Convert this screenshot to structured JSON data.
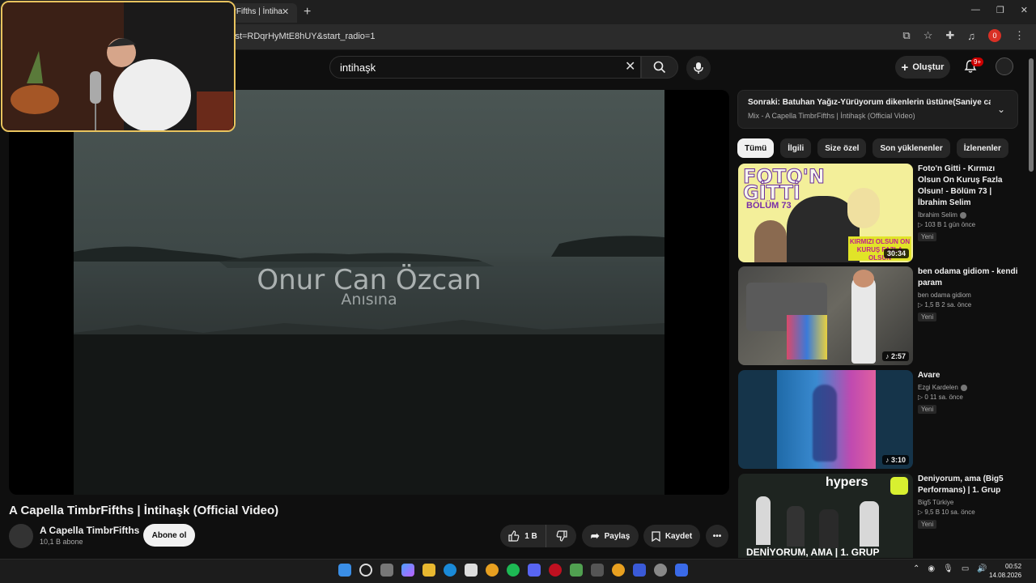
{
  "browser": {
    "tab_title": "brFifths | İntiha",
    "url": "ist=RDqrHyMtE8hUY&start_radio=1",
    "extension_badge": "0"
  },
  "header": {
    "search_value": "intihaşk",
    "create_label": "Oluştur",
    "notifications_badge": "9+"
  },
  "video": {
    "overlay_title": "Onur Can Özcan",
    "overlay_subtitle": "Anısına",
    "title": "A Capella TimbrFifths | İntihaşk (Official Video)",
    "channel": "A Capella TimbrFifths",
    "subscribers": "10,1 B abone",
    "subscribe_label": "Abone ol",
    "likes": "1 B",
    "share_label": "Paylaş",
    "save_label": "Kaydet"
  },
  "playlist": {
    "next_title": "Sonraki: Batuhan Yağız-Yürüyorum dikenlerin üstüne(Saniye canl...",
    "next_sub": "Mix - A Capella TimbrFifths | İntihaşk (Official Video)"
  },
  "chips": [
    "Tümü",
    "İlgili",
    "Size özel",
    "Son yüklenenler",
    "İzlenenler"
  ],
  "recommendations": [
    {
      "title": "Foto'n Gitti - Kırmızı Olsun On Kuruş Fazla Olsun! - Bölüm 73 | İbrahim Selim",
      "channel": "İbrahim Selim",
      "meta": "103 B   1 gün önce",
      "badge": "Yeni",
      "duration": "30:34"
    },
    {
      "title": "ben odama gidiom - kendi param",
      "channel": "ben odama gidiom",
      "meta": "1,5 B   2 sa. önce",
      "badge": "Yeni",
      "duration": "2:57"
    },
    {
      "title": "Avare",
      "channel": "Ezgi Kardelen",
      "meta": "0   11 sa. önce",
      "badge": "Yeni",
      "duration": "3:10"
    },
    {
      "title": "Deniyorum, ama (Big5 Performans) | 1. Grup",
      "channel": "Big5 Türkiye",
      "meta": "9,5 B   10 sa. önce",
      "badge": "Yeni",
      "duration": ""
    }
  ],
  "thumb_text": {
    "foto_1": "FOTO'N",
    "foto_2": "GİTTİ",
    "foto_3": "BÖLÜM 73",
    "foto_4": "KIRMIZI OLSUN ON KURUŞ FAZLA OLSUN",
    "hypers": "hypers",
    "deniyorum": "DENİYORUM, AMA | 1. GRUP"
  },
  "clock": {
    "time": "00:52",
    "date": "14.08.2026"
  }
}
